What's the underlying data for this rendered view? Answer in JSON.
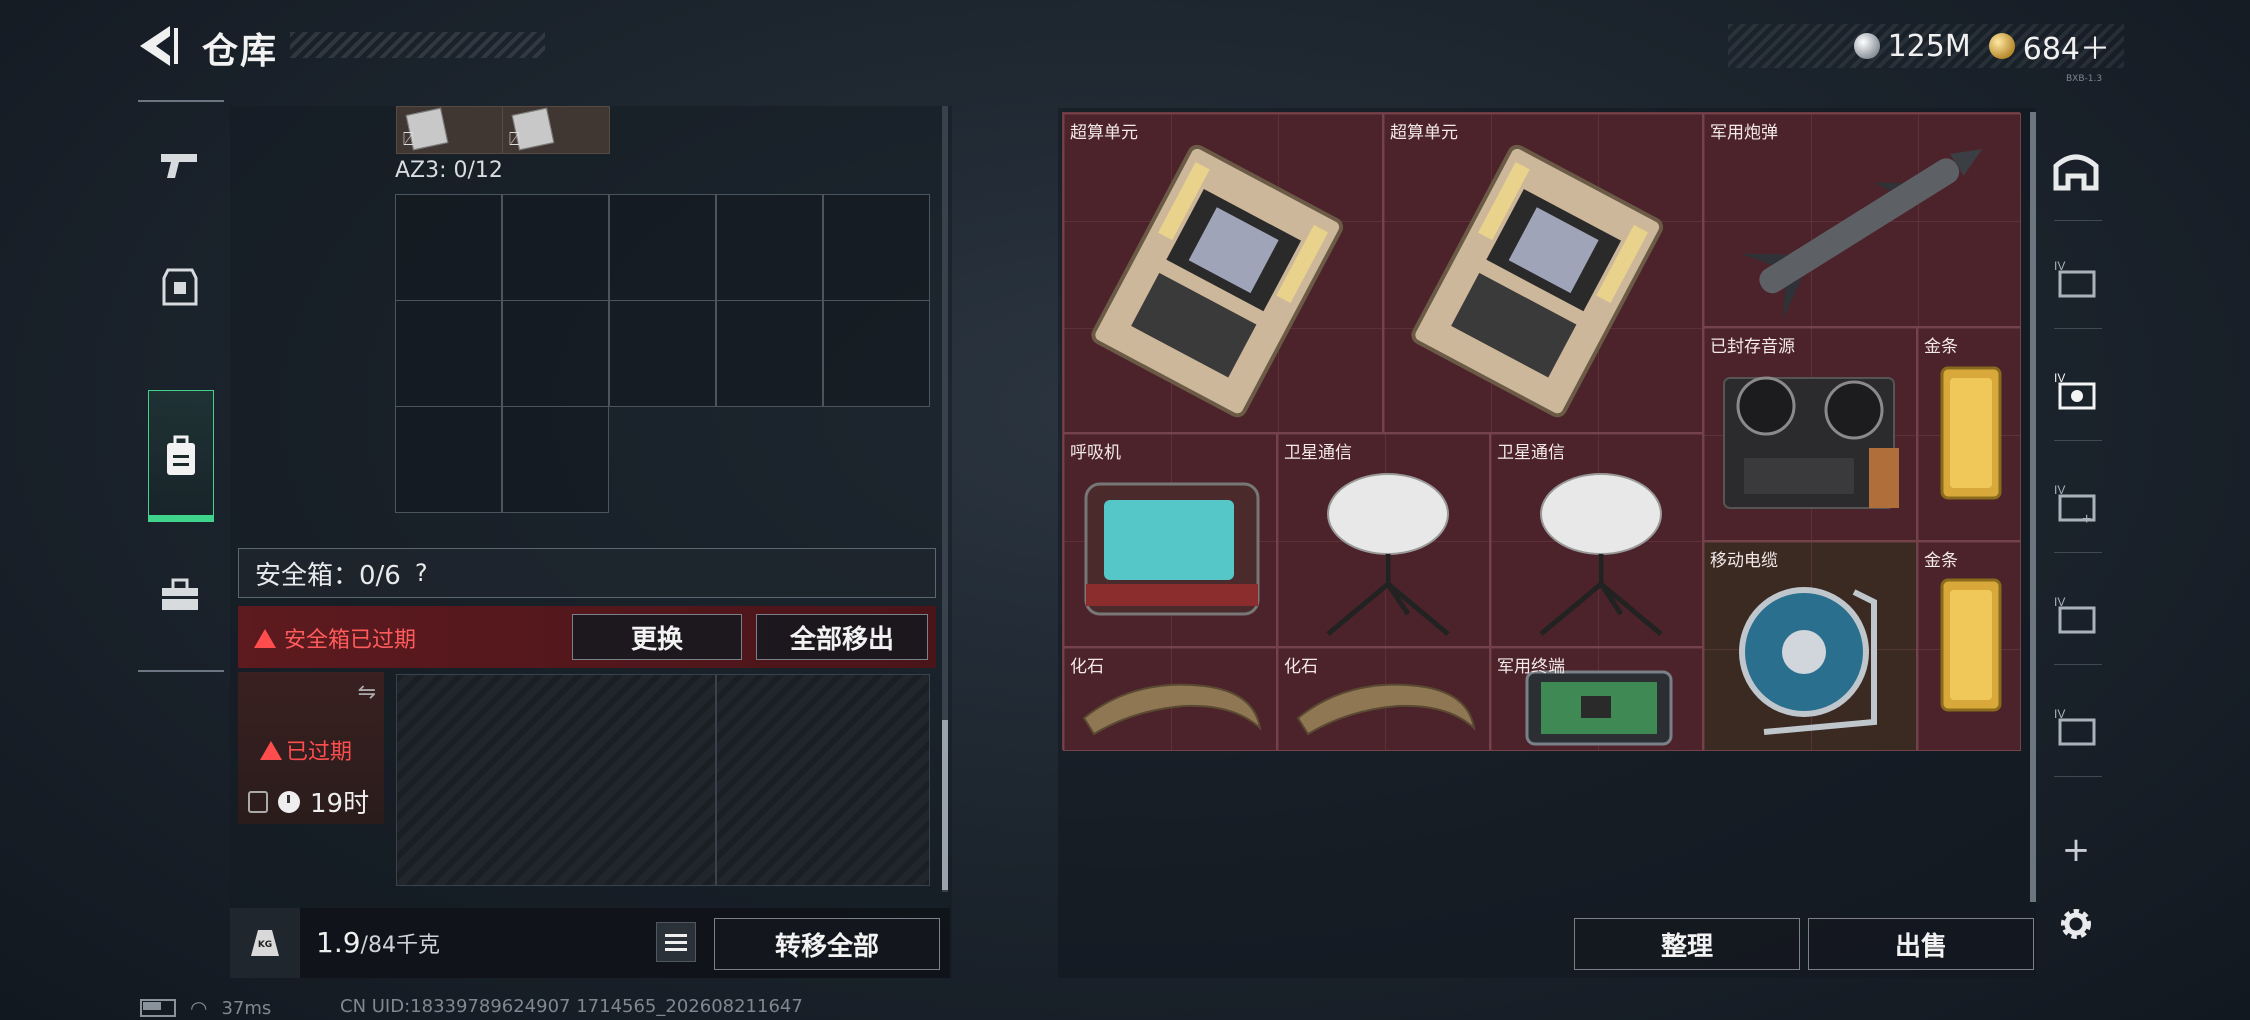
{
  "header": {
    "title": "仓库"
  },
  "currency": [
    {
      "icon": "silver-coin-icon",
      "value": "125M"
    },
    {
      "icon": "gold-coin-icon",
      "value": "684＋"
    }
  ],
  "left_rail": {
    "items": [
      "pistol-icon",
      "armor-icon",
      "backpack-icon",
      "toolbox-icon"
    ],
    "active_index": 2
  },
  "container": {
    "az3_label": "AZ3: 0/12"
  },
  "safe_box": {
    "label": "安全箱：0/6",
    "help": "?",
    "expired_text": "安全箱已过期",
    "replace_btn": "更换",
    "move_all_out_btn": "全部移出",
    "tile_status": "已过期",
    "tile_timer": "19时"
  },
  "bottom_left": {
    "weight_value": "1.9",
    "weight_max": "/84千克",
    "weight_icon_text": "KG",
    "transfer_all_btn": "转移全部"
  },
  "stash": {
    "items": [
      {
        "id": "cpu1",
        "label": "超算单元"
      },
      {
        "id": "cpu2",
        "label": "超算单元"
      },
      {
        "id": "missile",
        "label": "军用炮弹"
      },
      {
        "id": "tape",
        "label": "已封存音源"
      },
      {
        "id": "gold1",
        "label": "金条"
      },
      {
        "id": "resp",
        "label": "呼吸机"
      },
      {
        "id": "sat1",
        "label": "卫星通信"
      },
      {
        "id": "sat2",
        "label": "卫星通信"
      },
      {
        "id": "cable",
        "label": "移动电缆"
      },
      {
        "id": "gold2",
        "label": "金条"
      },
      {
        "id": "fossil1",
        "label": "化石"
      },
      {
        "id": "fossil2",
        "label": "化石"
      },
      {
        "id": "terminal",
        "label": "军用终端"
      }
    ],
    "sort_btn": "整理",
    "sell_btn": "出售"
  },
  "right_rail": {
    "items": [
      "home-tab-icon",
      "tab-1-icon",
      "tab-2-icon",
      "tab-3-icon",
      "tab-4-icon",
      "tab-5-icon"
    ],
    "add": "+",
    "settings": "gear-icon"
  },
  "status": {
    "ping": "37ms",
    "uid": "CN UID:18339789624907 1714565_202608211647",
    "tiny_version": "BXB-1.3"
  }
}
